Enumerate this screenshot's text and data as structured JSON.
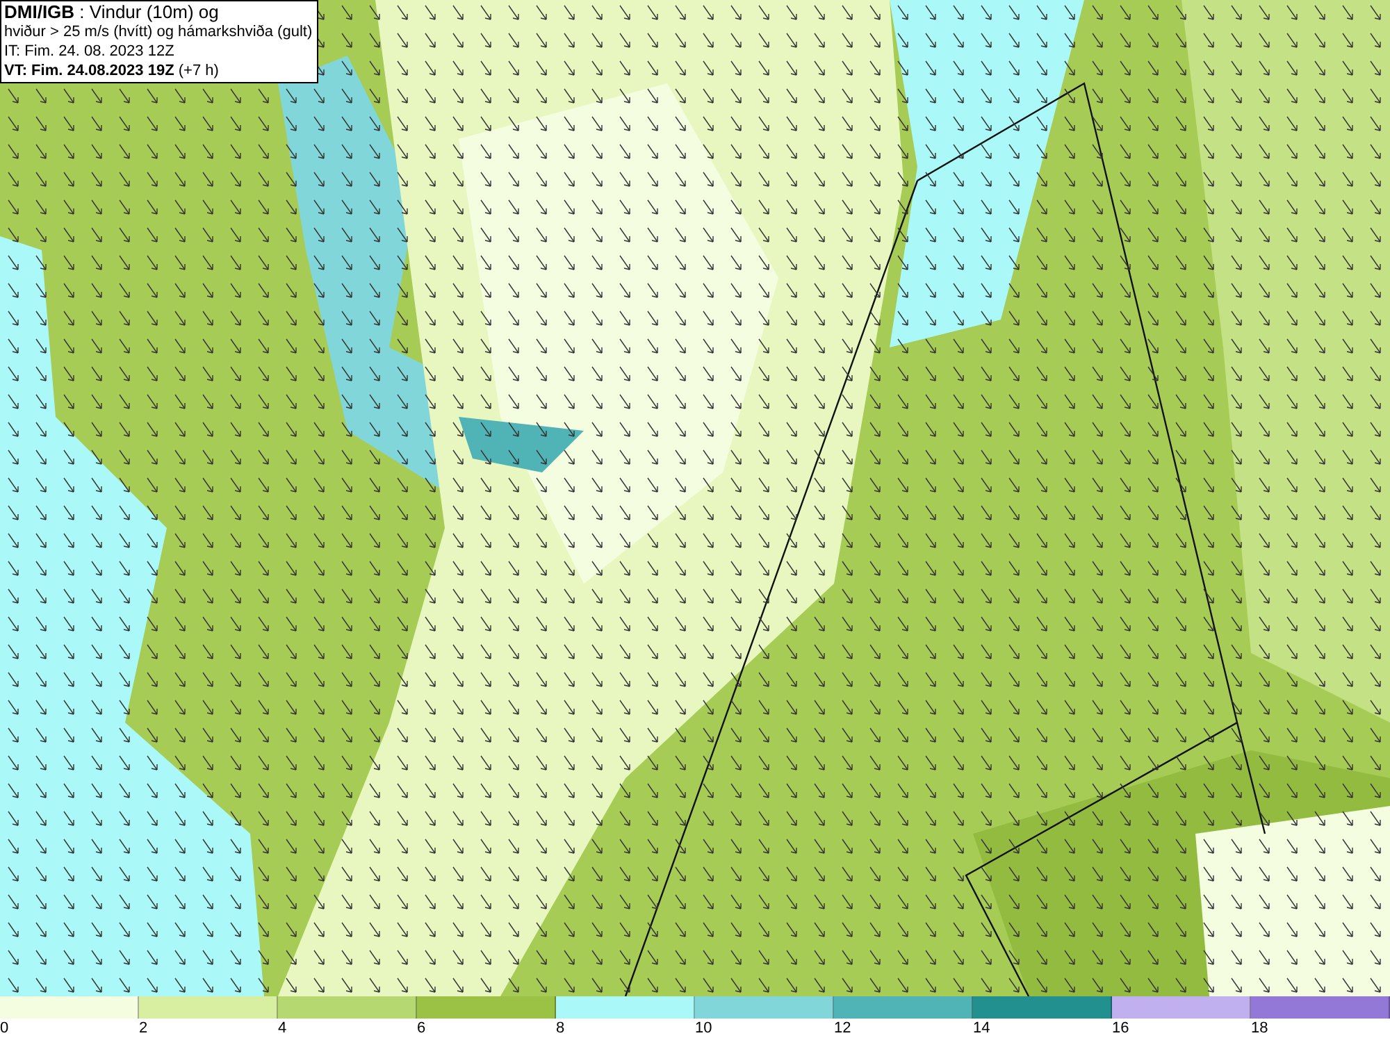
{
  "header": {
    "lines": [
      "**DMI/IGB** : Vindur (10m) og",
      "hviður > 25 m/s (hvítt) og hámarkshviða (gult)",
      "IT: Fim. 24. 08. 2023 12Z",
      "**VT: Fim. 24.08.2023 19Z** (+7 h)"
    ]
  },
  "legend": {
    "bins": [
      {
        "color": "#f5fde0",
        "label": "0"
      },
      {
        "color": "#d8eea0",
        "label": "2"
      },
      {
        "color": "#b5d970",
        "label": "4"
      },
      {
        "color": "#9bc245",
        "label": "6"
      },
      {
        "color": "#aaf8f8",
        "label": "8"
      },
      {
        "color": "#80d6d8",
        "label": "10"
      },
      {
        "color": "#50b3b5",
        "label": "12"
      },
      {
        "color": "#239090",
        "label": "14"
      },
      {
        "color": "#c0b0f0",
        "label": "16"
      },
      {
        "color": "#9478d8",
        "label": "18"
      }
    ]
  }
}
